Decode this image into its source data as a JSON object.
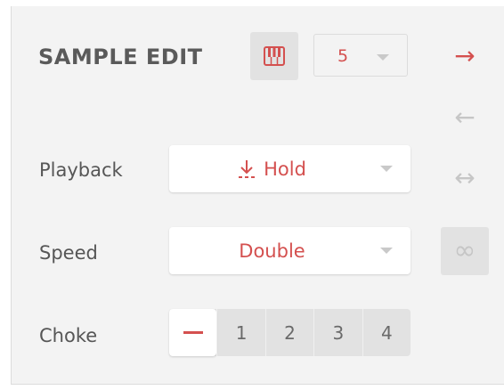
{
  "header": {
    "title": "SAMPLE EDIT",
    "number_select_value": "5"
  },
  "rows": {
    "playback": {
      "label": "Playback",
      "value": "Hold"
    },
    "speed": {
      "label": "Speed",
      "value": "Double"
    },
    "choke": {
      "label": "Choke",
      "options": [
        "—",
        "1",
        "2",
        "3",
        "4"
      ],
      "selected_index": 0
    }
  },
  "side_buttons": {
    "forward_glyph": "→",
    "reverse_glyph": "←",
    "pingpong_glyph": "↔",
    "loop_glyph": "∞"
  },
  "colors": {
    "accent": "#d4504f",
    "panel": "#f3f3f3",
    "control": "#e2e2e2",
    "text": "#565656"
  }
}
